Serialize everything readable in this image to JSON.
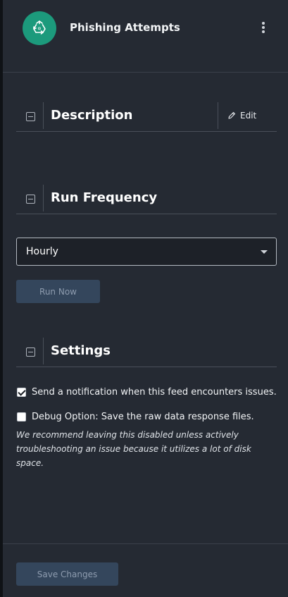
{
  "header": {
    "title": "Phishing Attempts",
    "logo_icon": "recycle-icon",
    "menu_icon": "kebab-menu-icon"
  },
  "sections": {
    "description": {
      "title": "Description",
      "edit_label": "Edit"
    },
    "run_frequency": {
      "title": "Run Frequency"
    },
    "settings": {
      "title": "Settings"
    }
  },
  "run_frequency": {
    "selected": "Hourly",
    "run_now_label": "Run Now"
  },
  "settings": {
    "notify": {
      "label": "Send a notification when this feed encounters issues.",
      "checked": true
    },
    "debug": {
      "label": "Debug Option: Save the raw data response files.",
      "checked": false
    },
    "debug_note": "We recommend leaving this disabled unless actively troubleshooting an issue because it utilizes a lot of disk space."
  },
  "footer": {
    "save_label": "Save Changes"
  },
  "colors": {
    "panel_bg": "#252a33",
    "accent_green": "#1c9a7c",
    "button_bg": "#34465c"
  }
}
